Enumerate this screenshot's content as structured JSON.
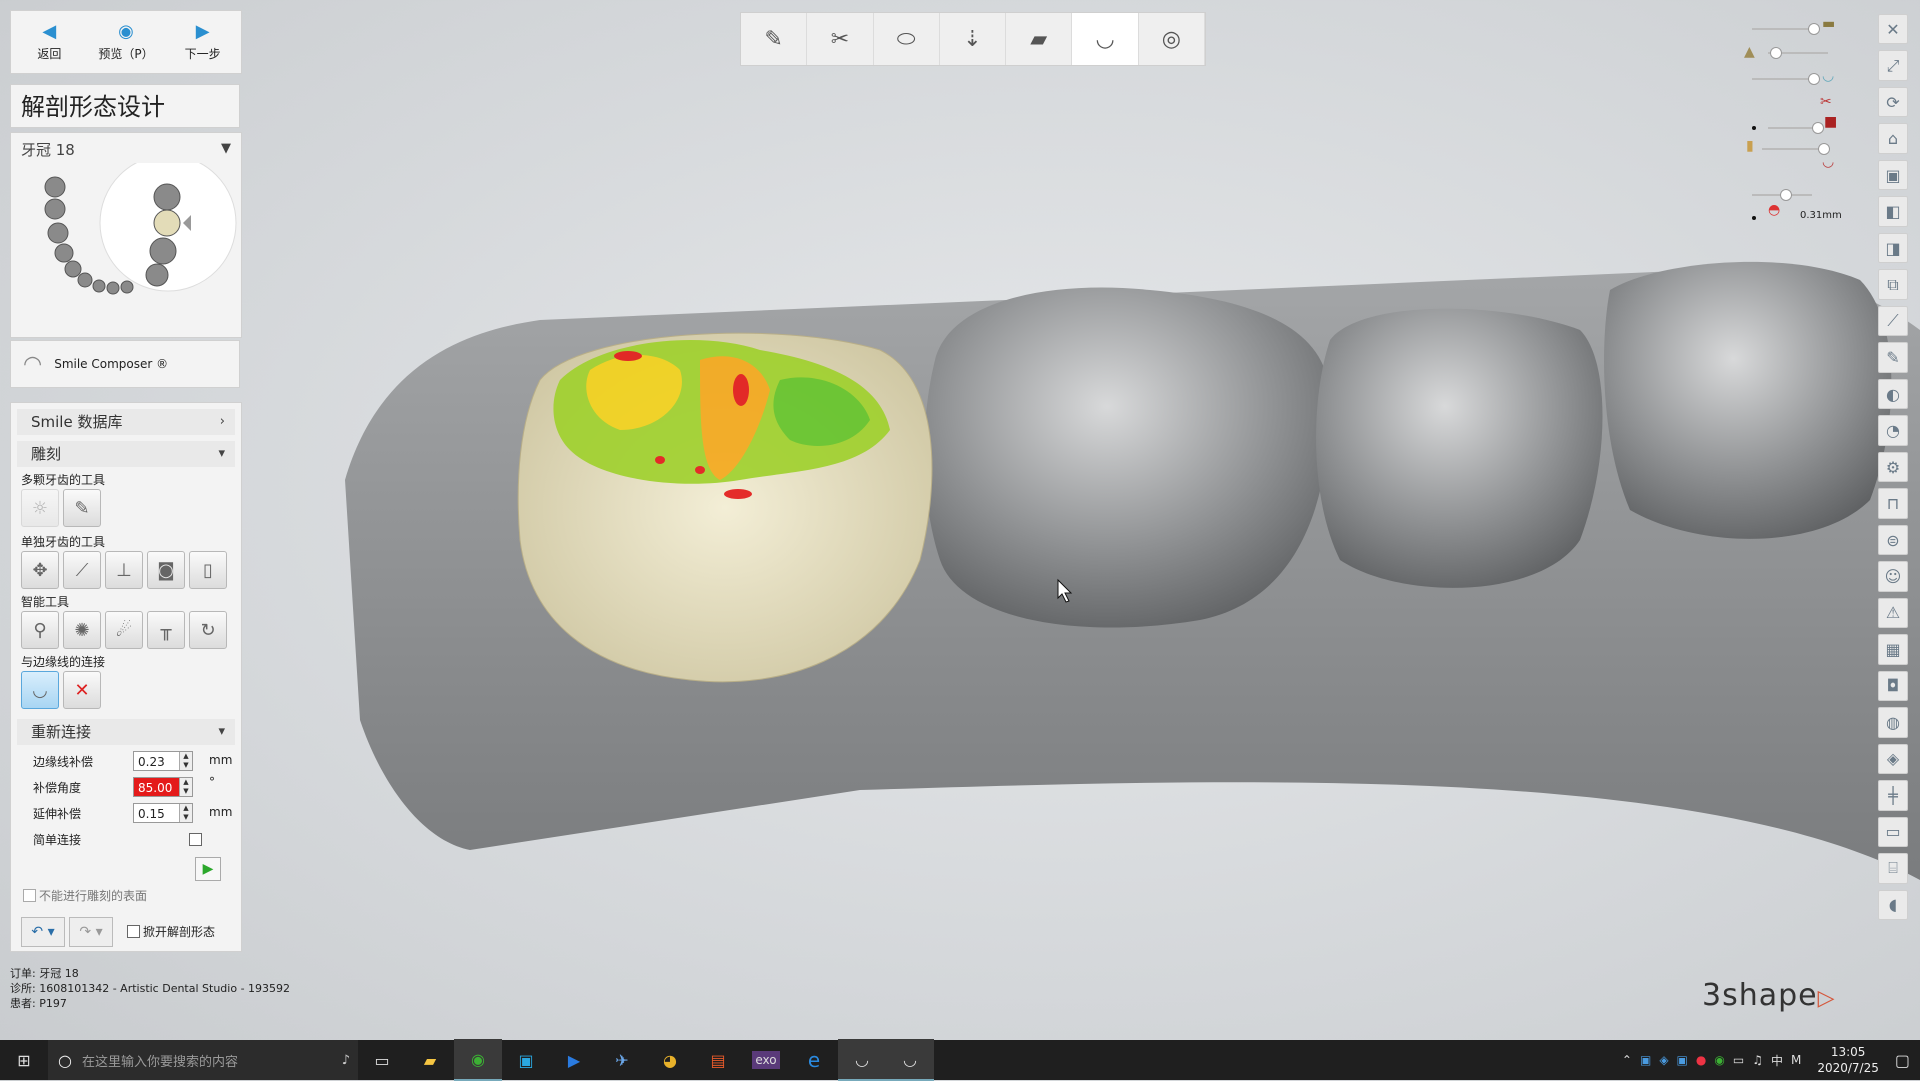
{
  "nav": {
    "back_label": "返回",
    "preview_label": "预览（P）",
    "next_label": "下一步"
  },
  "panel_title": "解剖形态设计",
  "crown": {
    "label": "牙冠 18"
  },
  "smile_composer": {
    "label": "Smile Composer ®"
  },
  "sections": {
    "smile_db": "Smile 数据库",
    "sculpt": "雕刻",
    "multi_tools": "多颗牙齿的工具",
    "single_tools": "单独牙齿的工具",
    "smart_tools": "智能工具",
    "margin_connect": "与边缘线的连接",
    "reconnect": "重新连接"
  },
  "reconnect_fields": {
    "margin_offset_label": "边缘线补偿",
    "margin_offset_value": "0.23",
    "angle_label": "补偿角度",
    "angle_value": "85.00",
    "extension_label": "延伸补偿",
    "extension_value": "0.15",
    "simple_label": "简单连接",
    "unit_mm": "mm",
    "unit_deg": "°"
  },
  "no_sculpt_label": "不能进行雕刻的表面",
  "unfold_label": "掀开解剖形态",
  "info": {
    "order_label": "订单:",
    "order_value": "牙冠 18",
    "clinic_label": "诊所:",
    "clinic_value": "1608101342 - Artistic Dental Studio - 193592",
    "patient_label": "患者:",
    "patient_value": "P197"
  },
  "thickness_readout": "0.31mm",
  "logo_text": "3shape",
  "taskbar": {
    "search_placeholder": "在这里输入你要搜索的内容",
    "time": "13:05",
    "date": "2020/7/25",
    "ime": "中",
    "ime_mode": "M",
    "exo_label": "exo"
  },
  "colors": {
    "accent": "#2a8fd0",
    "alert": "#e41a1a",
    "crown_base": "#ece6c8",
    "model_gray": "#8e9092"
  }
}
